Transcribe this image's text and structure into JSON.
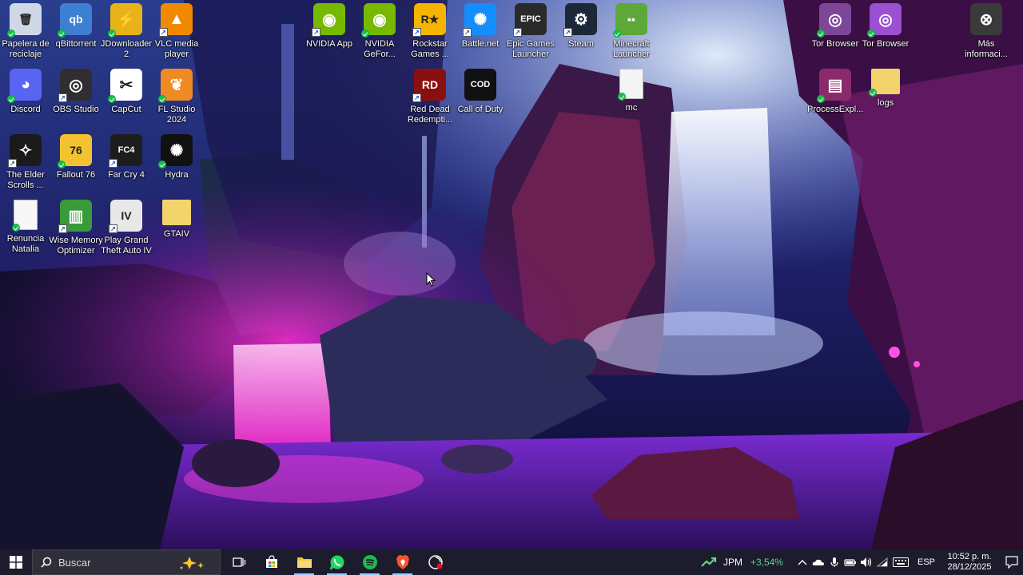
{
  "desktop": {
    "icons": [
      {
        "label": "Papelera de reciclaje",
        "icon": "recycle-bin-icon",
        "color": "#cfd8e6",
        "glyph": "🗑",
        "badge": "sync"
      },
      {
        "label": "qBittorrent",
        "icon": "qbittorrent-icon",
        "color": "#3d7fd3",
        "glyph": "qb",
        "badge": "sync"
      },
      {
        "label": "JDownloader 2",
        "icon": "jdownloader-icon",
        "color": "#e8b319",
        "glyph": "⚡",
        "badge": "sync"
      },
      {
        "label": "VLC media player",
        "icon": "vlc-icon",
        "color": "#f28a00",
        "glyph": "▲",
        "badge": "arrow"
      },
      {
        "label": "NVIDIA App",
        "icon": "nvidia-icon",
        "color": "#76b900",
        "glyph": "◉",
        "badge": "arrow"
      },
      {
        "label": "NVIDIA GeFor...",
        "icon": "nvidia-geforce-icon",
        "color": "#76b900",
        "glyph": "◉",
        "badge": "sync"
      },
      {
        "label": "Rockstar Games ...",
        "icon": "rockstar-icon",
        "color": "#f4b400",
        "glyph": "R★",
        "badge": "arrow"
      },
      {
        "label": "Battle.net",
        "icon": "battlenet-icon",
        "color": "#148eff",
        "glyph": "✺",
        "badge": "arrow"
      },
      {
        "label": "Epic Games Launcher",
        "icon": "epic-games-icon",
        "color": "#2a2a2a",
        "glyph": "EPIC",
        "badge": "arrow"
      },
      {
        "label": "Steam",
        "icon": "steam-icon",
        "color": "#1b2838",
        "glyph": "⚙",
        "badge": "arrow"
      },
      {
        "label": "Minecraft Launcher",
        "icon": "minecraft-icon",
        "color": "#5ea83a",
        "glyph": "▪▪",
        "badge": "sync"
      },
      {
        "label": "Tor Browser",
        "icon": "tor-browser-icon",
        "color": "#7d4698",
        "glyph": "◎",
        "badge": "sync"
      },
      {
        "label": "Tor Browser",
        "icon": "tor-browser-icon",
        "color": "#9b4fd1",
        "glyph": "◎",
        "badge": "sync"
      },
      {
        "label": "Más informaci...",
        "icon": "more-info-icon",
        "color": "#3a3a3a",
        "glyph": "⊗",
        "badge": "none"
      },
      {
        "label": "Discord",
        "icon": "discord-icon",
        "color": "#5865f2",
        "glyph": "◕",
        "badge": "sync"
      },
      {
        "label": "OBS Studio",
        "icon": "obs-icon",
        "color": "#302e31",
        "glyph": "◎",
        "badge": "arrow"
      },
      {
        "label": "CapCut",
        "icon": "capcut-icon",
        "color": "#ffffff",
        "glyph": "✂",
        "badge": "sync"
      },
      {
        "label": "FL Studio 2024",
        "icon": "fl-studio-icon",
        "color": "#f08a24",
        "glyph": "❦",
        "badge": "sync"
      },
      {
        "label": "Red Dead Redempti...",
        "icon": "red-dead-icon",
        "color": "#8a1010",
        "glyph": "RD",
        "badge": "arrow"
      },
      {
        "label": "Call of Duty",
        "icon": "call-of-duty-icon",
        "color": "#111111",
        "glyph": "COD",
        "badge": "none"
      },
      {
        "label": "mc",
        "icon": "file-icon",
        "color": "#f4f4f4",
        "glyph": "",
        "badge": "sync"
      },
      {
        "label": "ProcessExpl...",
        "icon": "winrar-icon",
        "color": "#8a2a6a",
        "glyph": "▤",
        "badge": "sync"
      },
      {
        "label": "logs",
        "icon": "folder-icon",
        "color": "#f3d36b",
        "glyph": "",
        "badge": "sync"
      },
      {
        "label": "The Elder Scrolls ...",
        "icon": "elder-scrolls-icon",
        "color": "#1a1a1a",
        "glyph": "✧",
        "badge": "arrow"
      },
      {
        "label": "Fallout 76",
        "icon": "fallout-icon",
        "color": "#f2c230",
        "glyph": "76",
        "badge": "sync"
      },
      {
        "label": "Far Cry 4",
        "icon": "far-cry-icon",
        "color": "#1d1d1d",
        "glyph": "FC4",
        "badge": "arrow"
      },
      {
        "label": "Hydra",
        "icon": "hydra-icon",
        "color": "#111111",
        "glyph": "✺",
        "badge": "sync"
      },
      {
        "label": "Renuncia Natalia",
        "icon": "document-icon",
        "color": "#f7f7f7",
        "glyph": "",
        "badge": "sync"
      },
      {
        "label": "Wise Memory Optimizer",
        "icon": "memory-optimizer-icon",
        "color": "#3a9a3a",
        "glyph": "▥",
        "badge": "arrow"
      },
      {
        "label": "Play Grand Theft Auto IV",
        "icon": "gta-iv-icon",
        "color": "#e8e8e8",
        "glyph": "IV",
        "badge": "arrow"
      },
      {
        "label": "GTAIV",
        "icon": "folder-icon",
        "color": "#f3d36b",
        "glyph": "",
        "badge": "none"
      }
    ]
  },
  "taskbar": {
    "search_placeholder": "Buscar",
    "apps": [
      {
        "name": "task-view",
        "icon": "task-view-icon",
        "open": false
      },
      {
        "name": "microsoft-store",
        "icon": "store-icon",
        "open": false
      },
      {
        "name": "file-explorer",
        "icon": "folder-icon",
        "open": true
      },
      {
        "name": "whatsapp",
        "icon": "whatsapp-icon",
        "open": true
      },
      {
        "name": "spotify",
        "icon": "spotify-icon",
        "open": true
      },
      {
        "name": "brave",
        "icon": "brave-icon",
        "open": true
      },
      {
        "name": "steam-capture",
        "icon": "recorder-icon",
        "open": false
      }
    ],
    "stock": {
      "symbol": "JPM",
      "change": "+3,54%"
    },
    "language": "ESP",
    "time": "10:52 p. m.",
    "date": "28/12/2025"
  },
  "colors": {
    "taskbar_bg": "#1c1c2c",
    "stock_up": "#5fd38a",
    "accent": "#9ec9ff"
  }
}
